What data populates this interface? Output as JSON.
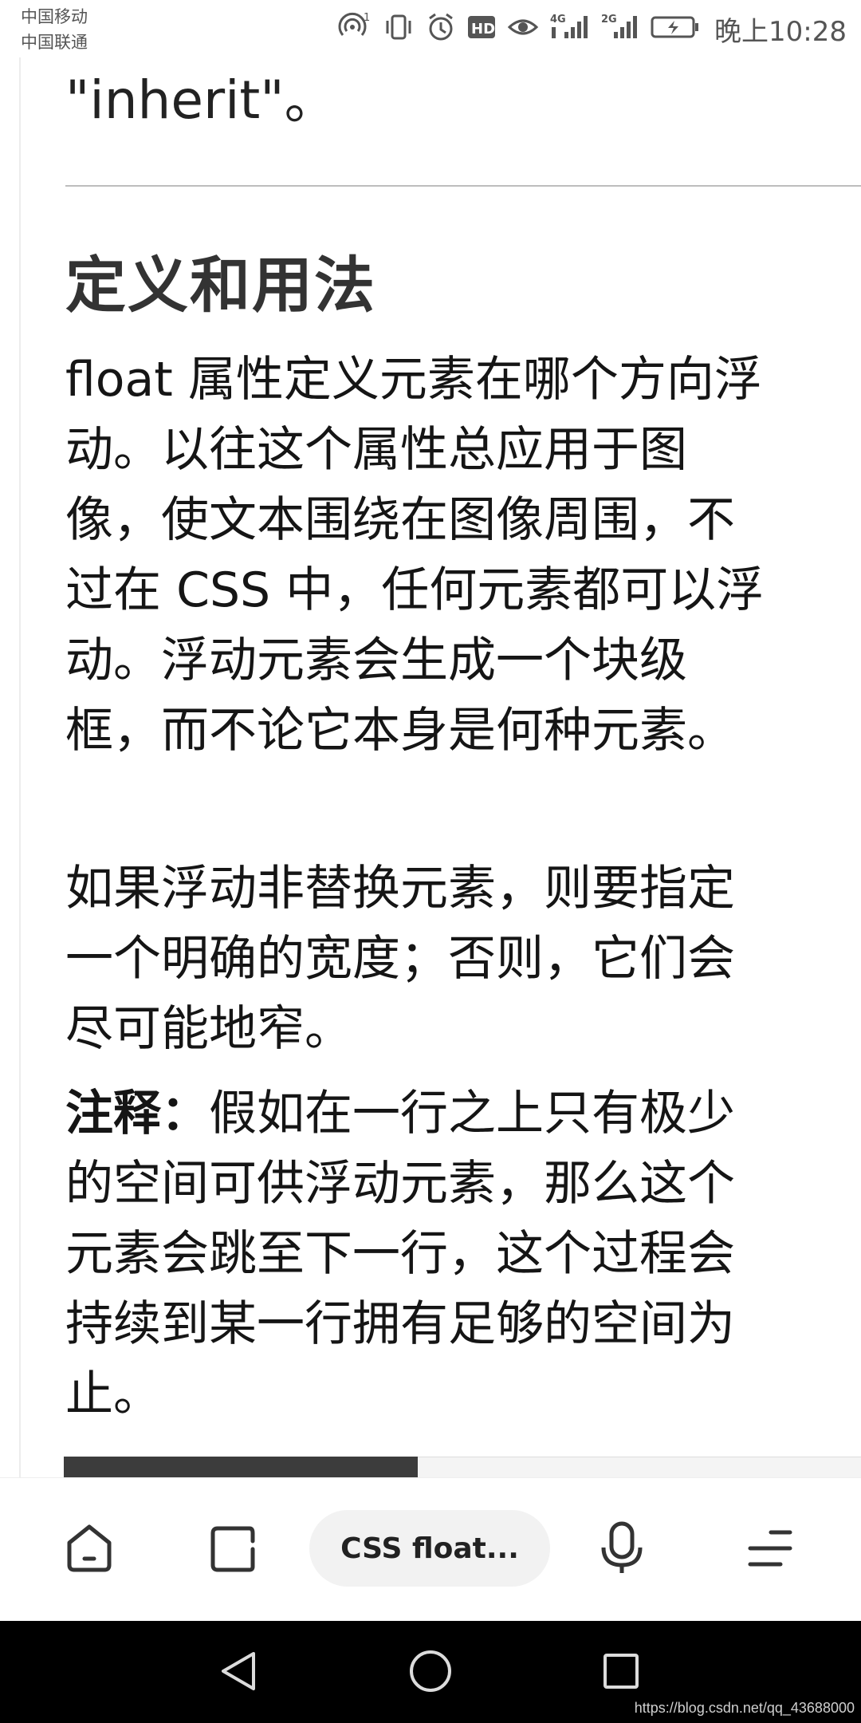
{
  "status_bar": {
    "carrier_1": "中国移动",
    "carrier_2": "中国联通",
    "time": "晚上10:28",
    "icons": [
      "hotspot-icon",
      "vibrate-icon",
      "alarm-icon",
      "hd-icon",
      "eye-comfort-icon",
      "signal-4g-icon",
      "signal-2g-icon",
      "battery-charging-icon"
    ]
  },
  "article": {
    "prev_text": "\"inherit\"。",
    "section_title": "定义和用法",
    "para1": "float 属性定义元素在哪个方向浮动。以往这个属性总应用于图像，使文本围绕在图像周围，不过在 CSS 中，任何元素都可以浮动。浮动元素会生成一个块级框，而不论它本身是何种元素。",
    "para2": "如果浮动非替换元素，则要指定一个明确的宽度；否则，它们会尽可能地窄。",
    "para3_label": "注释：",
    "para3_text": "假如在一行之上只有极少的空间可供浮动元素，那么这个元素会跳至下一行，这个过程会持续到某一行拥有足够的空间为止。"
  },
  "toolbar": {
    "address_label": "CSS float...",
    "icons": [
      "home-icon",
      "tabs-icon",
      "microphone-icon",
      "menu-icon"
    ]
  },
  "navigation_bar": {
    "icons": [
      "back-icon",
      "home-circle-icon",
      "recent-apps-icon"
    ]
  },
  "watermark": "https://blog.csdn.net/qq_43688000"
}
